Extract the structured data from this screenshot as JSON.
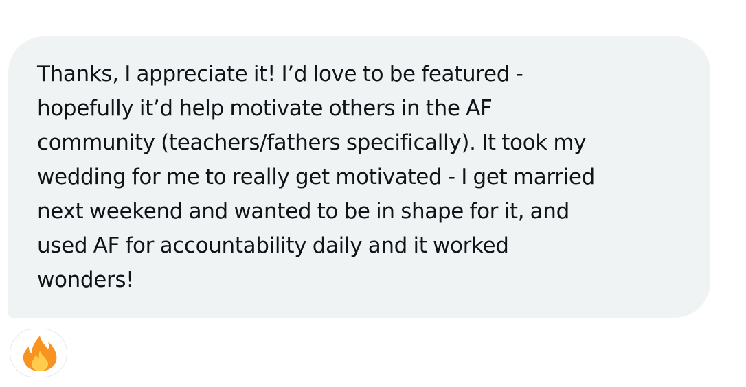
{
  "message": {
    "lines": [
      "Thanks, I appreciate it! I’d love to be featured -",
      "hopefully it’d help motivate others in the AF",
      "community (teachers/fathers specifically). It took my",
      "wedding for me to really get motivated - I get married",
      "next weekend and wanted to be in shape for it, and",
      "used AF for accountability daily and it worked",
      "wonders!"
    ],
    "bubble_color": "#eff3f4",
    "text_color": "#0f1419"
  },
  "reaction": {
    "icon": "fire-emoji-icon",
    "outer_color": "#f7931e",
    "inner_color": "#ffcc4d"
  }
}
